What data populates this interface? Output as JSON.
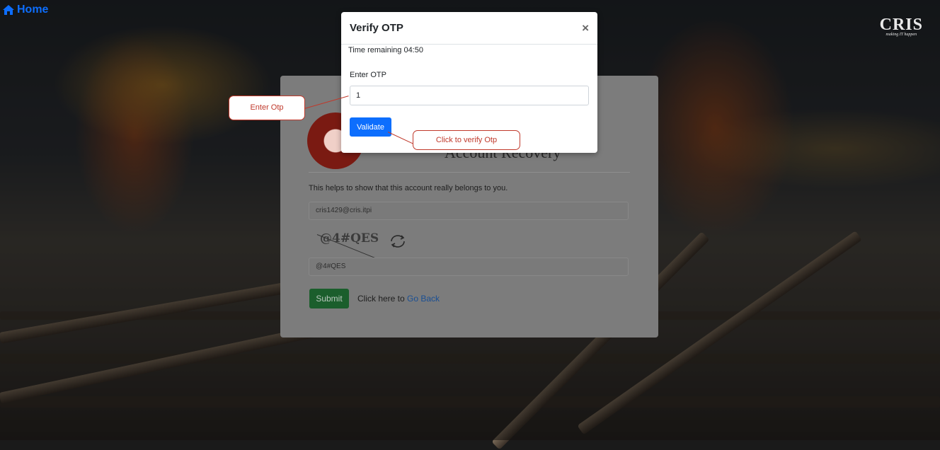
{
  "home": {
    "label": "Home",
    "icon": "home-icon"
  },
  "logo": {
    "name": "CRIS",
    "tagline": "making IT happen"
  },
  "recovery": {
    "title": "Account Recovery",
    "help_text": "This helps to show that this account really belongs to you.",
    "email_value": "cris1429@cris.itpi",
    "captcha_text": "@4#QES",
    "captcha_input_value": "@4#QES",
    "submit_label": "Submit",
    "back_prefix": "Click here to ",
    "back_link": "Go Back"
  },
  "modal": {
    "title": "Verify OTP",
    "close_label": "×",
    "time_remaining": "Time remaining 04:50",
    "otp_label": "Enter OTP",
    "otp_value": "1",
    "validate_label": "Validate"
  },
  "callouts": {
    "enter_otp": "Enter Otp",
    "verify_otp": "Click to verify Otp"
  },
  "colors": {
    "primary": "#0d6efd",
    "success": "#198754",
    "callout": "#c0392b"
  }
}
